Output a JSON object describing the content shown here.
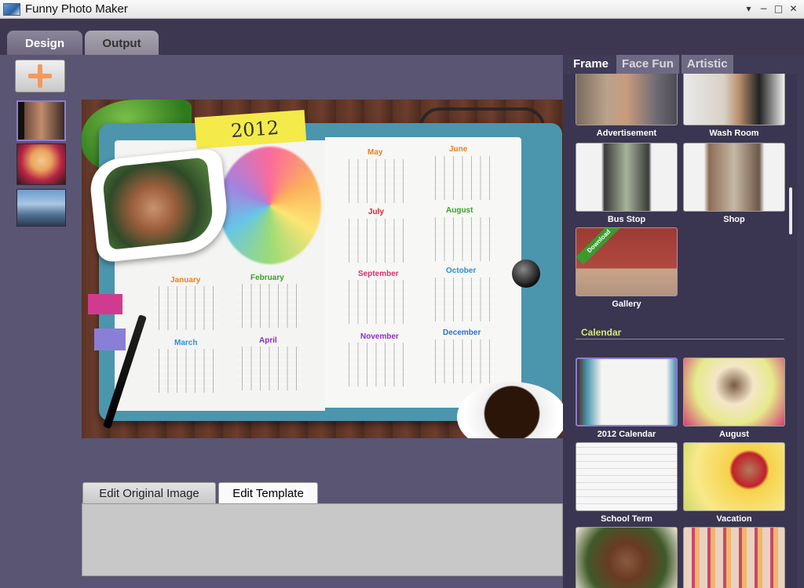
{
  "window": {
    "title": "Funny Photo Maker",
    "controls": [
      "▾",
      "−",
      "□",
      "✕"
    ]
  },
  "main_tabs": [
    {
      "label": "Design",
      "active": true
    },
    {
      "label": "Output",
      "active": false
    }
  ],
  "left_strip": {
    "add_icon": "plus-icon",
    "thumbnails": [
      {
        "name": "thumbnail-portrait-film",
        "selected": true
      },
      {
        "name": "thumbnail-blonde-woman",
        "selected": false
      },
      {
        "name": "thumbnail-cityscape",
        "selected": false
      }
    ]
  },
  "canvas": {
    "year": "2012",
    "months": [
      {
        "name": "January",
        "color": "#e8811a"
      },
      {
        "name": "February",
        "color": "#3aa02a"
      },
      {
        "name": "March",
        "color": "#2b8fd6"
      },
      {
        "name": "April",
        "color": "#8b2fc2"
      },
      {
        "name": "May",
        "color": "#e8811a"
      },
      {
        "name": "June",
        "color": "#e8811a"
      },
      {
        "name": "July",
        "color": "#d6222f"
      },
      {
        "name": "August",
        "color": "#3aa02a"
      },
      {
        "name": "September",
        "color": "#d62f6e"
      },
      {
        "name": "October",
        "color": "#2b8fd6"
      },
      {
        "name": "November",
        "color": "#8b2fc2"
      },
      {
        "name": "December",
        "color": "#2b6fd6"
      }
    ]
  },
  "edit_tabs": [
    {
      "label": "Edit Original Image",
      "active": false
    },
    {
      "label": "Edit Template",
      "active": true
    }
  ],
  "right_panel": {
    "category_tabs": [
      {
        "label": "Frame",
        "active": true
      },
      {
        "label": "Face Fun",
        "active": false
      },
      {
        "label": "Artistic",
        "active": false
      }
    ],
    "frame_tiles": [
      {
        "label": "Advertisement"
      },
      {
        "label": "Wash Room"
      },
      {
        "label": "Bus Stop"
      },
      {
        "label": "Shop"
      },
      {
        "label": "Gallery",
        "badge": "Download"
      }
    ],
    "calendar_section_title": "Calendar",
    "calendar_tiles": [
      {
        "label": "2012 Calendar",
        "selected": true
      },
      {
        "label": "August"
      },
      {
        "label": "School Term"
      },
      {
        "label": "Vacation"
      },
      {
        "label": ""
      },
      {
        "label": ""
      }
    ]
  },
  "colors": {
    "background": "#3d3751",
    "panel": "#5a5572",
    "accent": "#8d7bd8",
    "section_title": "#d6e77a",
    "plus": "#f39a5c"
  }
}
